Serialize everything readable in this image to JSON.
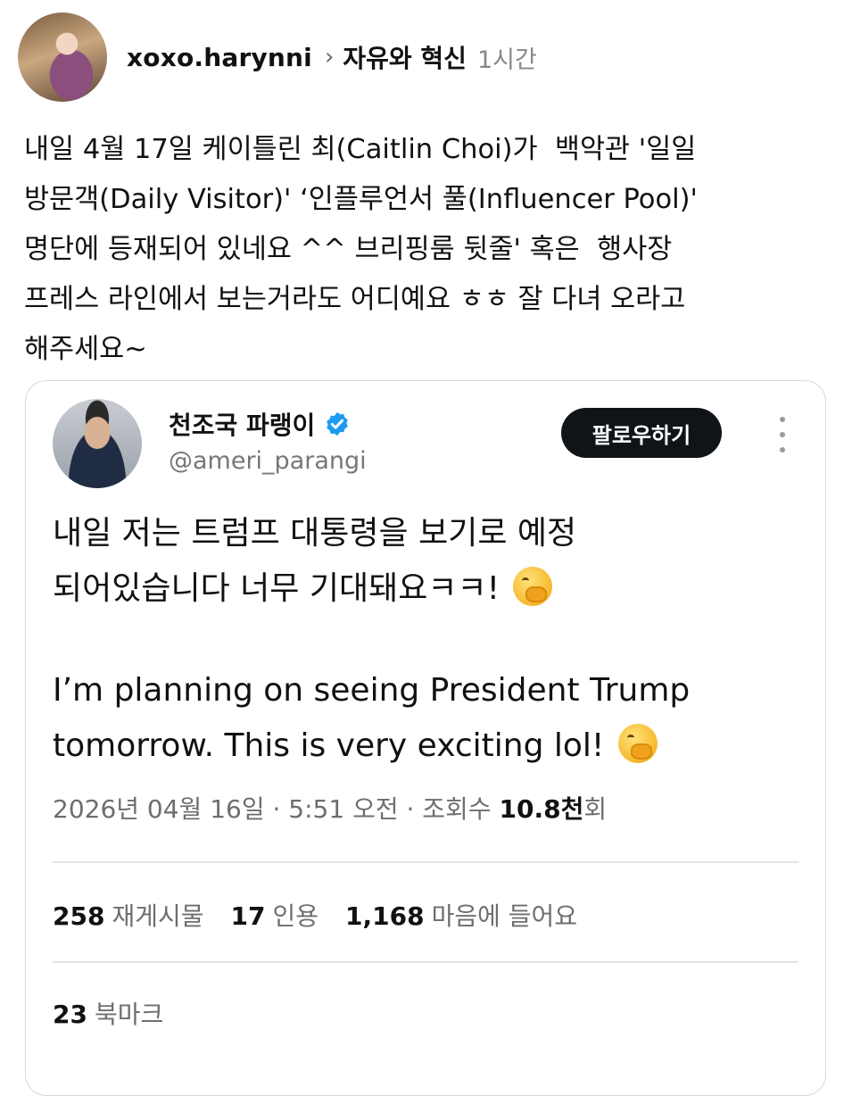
{
  "post": {
    "author": "xoxo.harynni",
    "community": "자유와 혁신",
    "time": "1시간",
    "body_lines": [
      "내일 4월 17일 케이틀린 최(Caitlin Choi)가  백악관 '일일",
      "방문객(Daily Visitor)' ‘인플루언서 풀(Influencer Pool)'",
      "명단에 등재되어 있네요 ^^ 브리핑룸 뒷줄' 혹은  행사장",
      "프레스 라인에서 보는거라도 어디예요 ㅎㅎ 잘 다녀 오라고",
      "해주세요~"
    ]
  },
  "tweet": {
    "name": "천조국 파랭이",
    "handle": "@ameri_parangi",
    "follow_label": "팔로우하기",
    "text_ko_1": "내일 저는 트럼프 대통령을 보기로 예정",
    "text_ko_2": "되어있습니다 너무 기대돼요ㅋㅋ!",
    "text_en_1": "I’m planning on seeing President Trump",
    "text_en_2": "tomorrow. This is very exciting lol!",
    "meta_prefix": "2026년 04월 16일 · 5:51 오전 · 조회수",
    "views": "10.8천",
    "views_suffix": "회",
    "reposts_count": "258",
    "reposts_label": "재게시물",
    "quotes_count": "17",
    "quotes_label": "인용",
    "likes_count": "1,168",
    "likes_label": "마음에 들어요",
    "bookmarks_count": "23",
    "bookmarks_label": "북마크"
  },
  "icons": {
    "verified": "verified-badge-icon",
    "more": "more-vertical-icon",
    "chevron": "chevron-right-icon",
    "emoji": "face-with-hand-over-mouth-icon"
  },
  "colors": {
    "verified_blue": "#1d9bf0",
    "follow_bg": "#0f1419",
    "muted_text": "#6e6e6e"
  }
}
